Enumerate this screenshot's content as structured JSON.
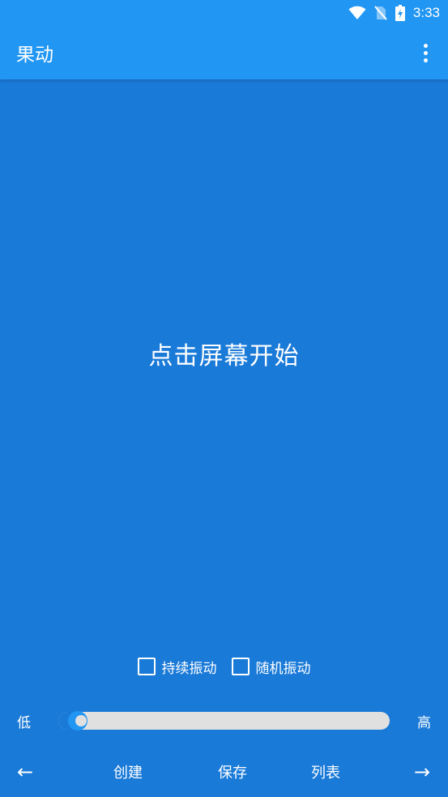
{
  "status_bar": {
    "time": "3:33",
    "icons": [
      "wifi-icon",
      "no-sim-icon",
      "battery-charging-icon"
    ]
  },
  "app_bar": {
    "title": "果动",
    "menu_icon": "more-vert-icon"
  },
  "main": {
    "prompt": "点击屏幕开始"
  },
  "options": {
    "continuous_label": "持续振动",
    "continuous_checked": false,
    "random_label": "随机振动",
    "random_checked": false
  },
  "intensity": {
    "low_label": "低",
    "high_label": "高",
    "value": 0.03
  },
  "bottom_nav": {
    "prev": "←",
    "create": "创建",
    "save": "保存",
    "list": "列表",
    "next": "→"
  },
  "colors": {
    "primary": "#2196f3",
    "background": "#1a7ad8",
    "track": "#e0e0e0"
  }
}
